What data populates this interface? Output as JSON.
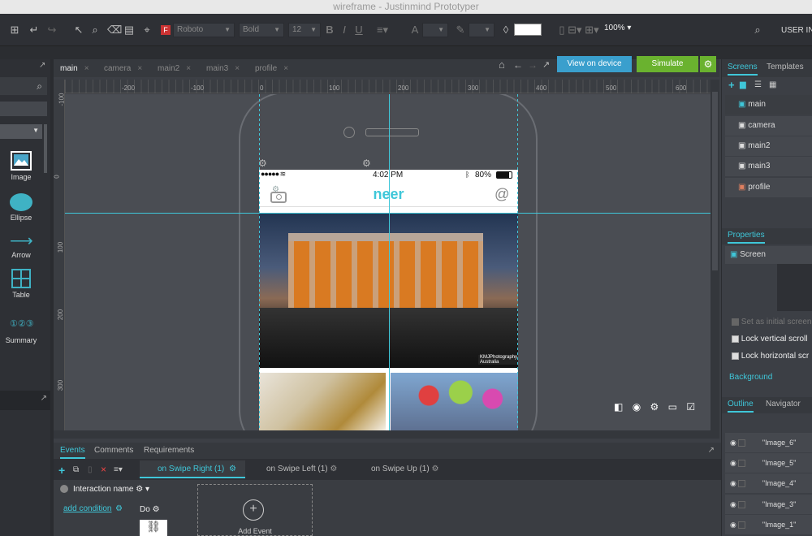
{
  "window": {
    "title": "wireframe - Justinmind Prototyper"
  },
  "toolbar": {
    "font": "Roboto",
    "weight": "Bold",
    "size": "12",
    "zoom": "100%",
    "user": "USER INT"
  },
  "left_palette": [
    {
      "label": "Image",
      "icon": "image-icon"
    },
    {
      "label": "Ellipse",
      "icon": "ellipse-icon"
    },
    {
      "label": "Arrow",
      "icon": "arrow-icon"
    },
    {
      "label": "Table",
      "icon": "table-icon"
    },
    {
      "label": "Summary",
      "icon": "summary-icon"
    }
  ],
  "doc_tabs": [
    {
      "label": "main",
      "active": true
    },
    {
      "label": "camera"
    },
    {
      "label": "main2"
    },
    {
      "label": "main3"
    },
    {
      "label": "profile"
    }
  ],
  "actions": {
    "view_on_device": "View on device",
    "simulate": "Simulate"
  },
  "rulers": {
    "top": [
      "-200",
      "-100",
      "0",
      "100",
      "200",
      "300",
      "400",
      "500",
      "600"
    ],
    "left": [
      "-100",
      "0",
      "100",
      "200",
      "300"
    ]
  },
  "phone": {
    "time": "4:02 PM",
    "battery": "80%",
    "app_title": "neer",
    "photo_credit": "KMJPhotography Australia"
  },
  "bottom": {
    "tabs": [
      "Events",
      "Comments",
      "Requirements"
    ],
    "event_tabs": [
      "on Swipe Right (1)",
      "on Swipe Left (1)",
      "on Swipe Up (1)"
    ],
    "interaction_name": "Interaction name",
    "add_condition": "add condition",
    "do_label": "Do",
    "add_event": "Add Event"
  },
  "right": {
    "tabs": [
      "Screens",
      "Templates"
    ],
    "screens": [
      "main",
      "camera",
      "main2",
      "main3",
      "profile"
    ],
    "properties_tab": "Properties",
    "screen_label": "Screen",
    "set_initial": "Set as initial screen",
    "lock_vertical": "Lock vertical scroll",
    "lock_horizontal": "Lock horizontal scr",
    "background": "Background",
    "outline_tabs": [
      "Outline",
      "Navigator"
    ],
    "outline_items": [
      "\"Image_6\"",
      "\"Image_5\"",
      "\"Image_4\"",
      "\"Image_3\"",
      "\"Image_1\""
    ]
  },
  "colors": {
    "accent": "#3fc7d9",
    "view_btn": "#3a9fcd",
    "simulate_btn": "#6ab22f"
  }
}
